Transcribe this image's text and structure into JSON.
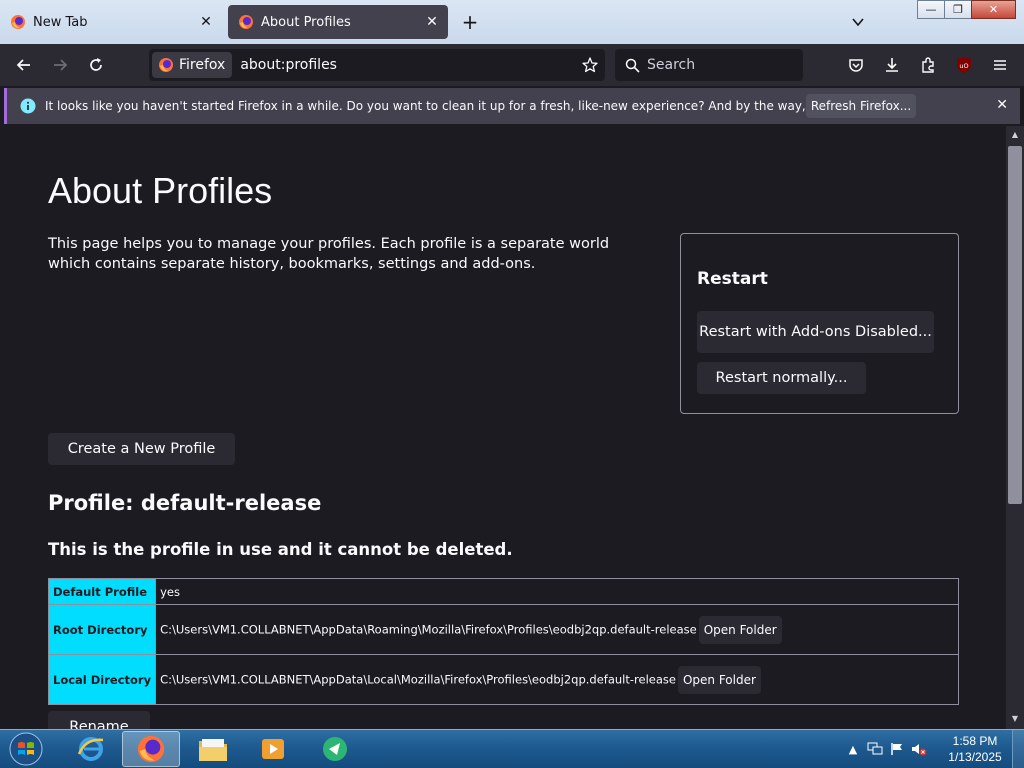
{
  "tabs": [
    {
      "title": "New Tab",
      "close": "✕"
    },
    {
      "title": "About Profiles",
      "close": "✕"
    }
  ],
  "newtab_label": "+",
  "window_controls": {
    "minimize": "—",
    "maximize": "❐",
    "close": "✕"
  },
  "urlbar": {
    "identity_label": "Firefox",
    "url": "about:profiles"
  },
  "search": {
    "placeholder": "Search"
  },
  "notification": {
    "message": "It looks like you haven't started Firefox in a while. Do you want to clean it up for a fresh, like-new experience? And by the way, welcome back!",
    "button": "Refresh Firefox...",
    "close": "✕"
  },
  "page": {
    "title": "About Profiles",
    "intro": "This page helps you to manage your profiles. Each profile is a separate world which contains separate history, bookmarks, settings and add-ons.",
    "create_button": "Create a New Profile",
    "restart": {
      "title": "Restart",
      "addons_button": "Restart with Add-ons Disabled...",
      "normal_button": "Restart normally..."
    },
    "profile": {
      "title": "Profile: default-release",
      "in_use": "This is the profile in use and it cannot be deleted.",
      "rows": [
        {
          "label": "Default Profile",
          "value": "yes"
        },
        {
          "label": "Root Directory",
          "value": "C:\\Users\\VM1.COLLABNET\\AppData\\Roaming\\Mozilla\\Firefox\\Profiles\\eodbj2qp.default-release",
          "button": "Open Folder"
        },
        {
          "label": "Local Directory",
          "value": "C:\\Users\\VM1.COLLABNET\\AppData\\Local\\Mozilla\\Firefox\\Profiles\\eodbj2qp.default-release",
          "button": "Open Folder"
        }
      ],
      "rename_button": "Rename"
    }
  },
  "taskbar": {
    "clock_time": "1:58 PM",
    "clock_date": "1/13/2025",
    "tray_arrow": "▲"
  },
  "colors": {
    "accent": "#00ddff",
    "page_bg": "#1c1b22",
    "notification_accent": "#a36bdb"
  }
}
